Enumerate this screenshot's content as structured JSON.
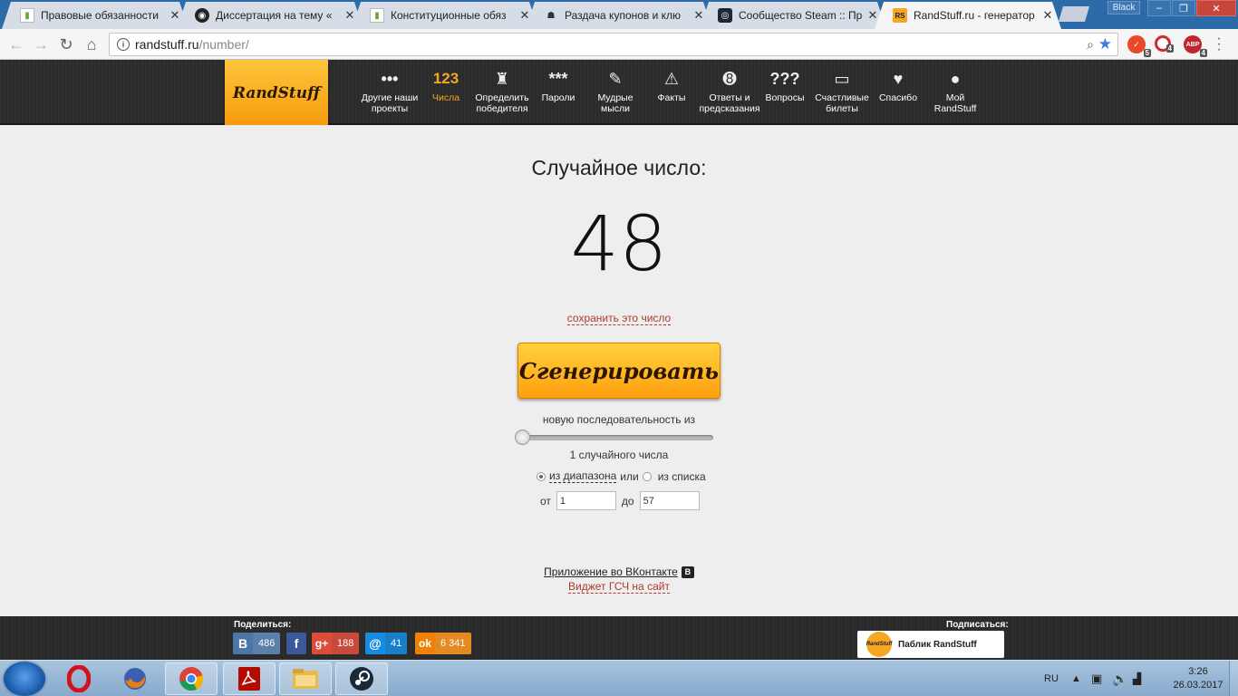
{
  "browser": {
    "tabs": [
      {
        "title": "Правовые обязанности",
        "icon": "bar-chart-icon",
        "active": false
      },
      {
        "title": "Диссертация на тему «",
        "icon": "film-reel-icon",
        "active": false
      },
      {
        "title": "Конституционные обяз",
        "icon": "bar-chart-icon",
        "active": false
      },
      {
        "title": "Раздача купонов и клю",
        "icon": "game-icon",
        "active": false
      },
      {
        "title": "Сообщество Steam :: Пр",
        "icon": "steam-icon",
        "active": false
      },
      {
        "title": "RandStuff.ru - генератор",
        "icon": "randstuff-icon",
        "active": true
      }
    ],
    "profile": "Black",
    "url_host": "randstuff.ru",
    "url_path": "/number/",
    "extensions": [
      {
        "name": "vpn-extension-icon",
        "badge": "5",
        "color": "#e8472a"
      },
      {
        "name": "opera-extension-icon",
        "badge": "4",
        "color": "#d12a2a"
      },
      {
        "name": "adblock-extension-icon",
        "badge": "4",
        "color": "#c0262d",
        "label": "ABP"
      }
    ]
  },
  "site": {
    "logo": "RandStuff",
    "nav": [
      {
        "label": "Другие наши проекты",
        "icon": "more-dots-icon",
        "glyph": "•••"
      },
      {
        "label": "Числа",
        "icon": "numbers-icon",
        "glyph": "123",
        "active": true
      },
      {
        "label": "Определить победителя",
        "icon": "trophy-icon",
        "glyph": "🏆"
      },
      {
        "label": "Пароли",
        "icon": "password-icon",
        "glyph": "***"
      },
      {
        "label": "Мудрые мысли",
        "icon": "scroll-icon",
        "glyph": "✎"
      },
      {
        "label": "Факты",
        "icon": "warning-icon",
        "glyph": "!"
      },
      {
        "label": "Ответы и предсказания",
        "icon": "magic-ball-icon",
        "glyph": "8"
      },
      {
        "label": "Вопросы",
        "icon": "questions-icon",
        "glyph": "???"
      },
      {
        "label": "Счастливые билеты",
        "icon": "ticket-icon",
        "glyph": "▭"
      },
      {
        "label": "Спасибо",
        "icon": "heart-icon",
        "glyph": "♥"
      },
      {
        "label": "Мой RandStuff",
        "icon": "user-icon",
        "glyph": "👤"
      }
    ]
  },
  "generator": {
    "heading": "Случайное число:",
    "number": "48",
    "save_link": "сохранить это число",
    "button": "Сгенерировать",
    "sequence_label": "новую последовательность из",
    "count_value": 1,
    "count_label": "1 случайного числа",
    "mode_range": "из диапазона",
    "mode_or": "или",
    "mode_list": "из списка",
    "from_label": "от",
    "from_value": "1",
    "to_label": "до",
    "to_value": "57",
    "vk_app_link": "Приложение во ВКонтакте",
    "widget_link": "Виджет ГСЧ на сайт"
  },
  "footer": {
    "share_label": "Поделиться:",
    "share": [
      {
        "name": "vk",
        "glyph": "В",
        "count": "486",
        "color": "#4a76a8",
        "dark": "#3d6592"
      },
      {
        "name": "facebook",
        "glyph": "f",
        "count": "",
        "color": "#3b5998",
        "dark": "#3b5998"
      },
      {
        "name": "google-plus",
        "glyph": "g+",
        "count": "188",
        "color": "#dd4b39",
        "dark": "#c23f2f"
      },
      {
        "name": "mail",
        "glyph": "@",
        "count": "41",
        "color": "#168de2",
        "dark": "#0f77c2"
      },
      {
        "name": "odnoklassniki",
        "glyph": "ok",
        "count": "6 341",
        "color": "#ee8208",
        "dark": "#d87406"
      }
    ],
    "subscribe_label": "Подписаться:",
    "subscribe_button": "Паблик RandStuff"
  },
  "taskbar": {
    "lang": "RU",
    "time": "3:26",
    "date": "26.03.2017",
    "apps": [
      "opera-icon",
      "firefox-icon",
      "chrome-icon",
      "acrobat-icon",
      "file-explorer-icon",
      "steam-icon"
    ]
  }
}
